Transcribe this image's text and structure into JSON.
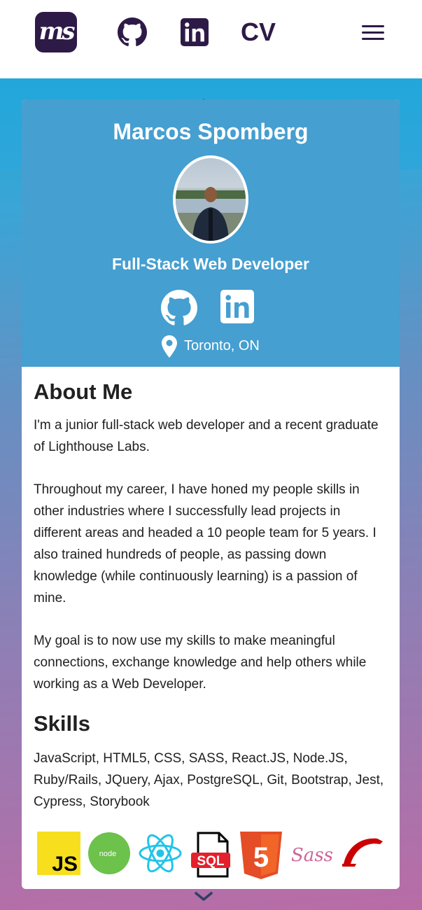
{
  "nav": {
    "logo_text": "ms",
    "cv_label": "CV",
    "icons": [
      "github-icon",
      "linkedin-icon",
      "menu-icon"
    ]
  },
  "profile": {
    "name": "Marcos Spomberg",
    "role": "Full-Stack Web Developer",
    "location": "Toronto, ON",
    "icons": [
      "github-icon",
      "linkedin-icon",
      "location-pin-icon"
    ]
  },
  "about": {
    "heading": "About Me",
    "paragraph_1": "I'm a junior full-stack web developer and a recent graduate of Lighthouse Labs.",
    "paragraph_2": "Throughout my career, I have honed my people skills in other industries where I successfully lead projects in different areas and headed a 10 people team for 5 years. I also trained hundreds of people, as passing down knowledge (while continuously learning) is a passion of mine.",
    "paragraph_3": "My goal is to now use my skills to make meaningful connections, exchange knowledge and help others while working as a Web Developer."
  },
  "skills": {
    "heading": "Skills",
    "list": "JavaScript, HTML5, CSS, SASS, React.JS, Node.JS, Ruby/Rails, JQuery, Ajax, PostgreSQL, Git, Bootstrap, Jest, Cypress, Storybook",
    "logos": [
      {
        "name": "javascript-logo",
        "text": "JS"
      },
      {
        "name": "nodejs-logo",
        "text": "node"
      },
      {
        "name": "react-logo"
      },
      {
        "name": "sql-logo",
        "text": "SQL"
      },
      {
        "name": "html5-logo",
        "text": "5"
      },
      {
        "name": "sass-logo",
        "text": "Sass"
      },
      {
        "name": "rails-logo"
      }
    ]
  },
  "colors": {
    "nav_dark": "#2e1a47",
    "card_header": "#459fd0",
    "gradient_top": "#1fa8d6",
    "gradient_bottom": "#b96ca6"
  }
}
